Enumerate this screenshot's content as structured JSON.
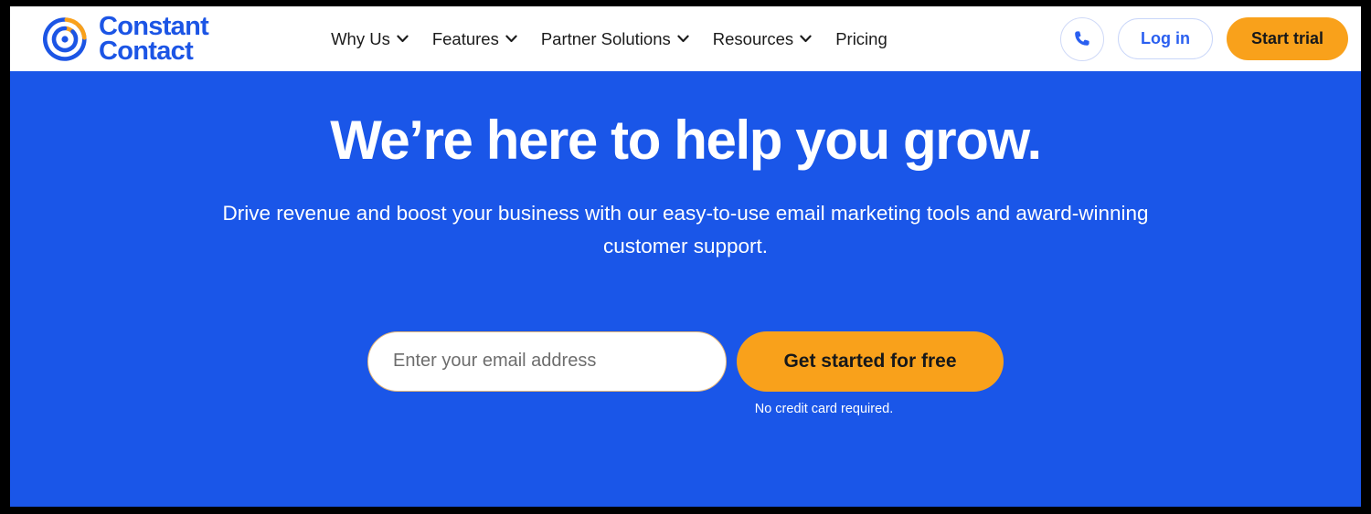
{
  "brand": {
    "name_line1": "Constant",
    "name_line2": "Contact",
    "logo_icon": "constant-contact-logo-icon",
    "blue": "#1a56e8",
    "orange": "#f9a11b",
    "logo_blue": "#1c55e5"
  },
  "header": {
    "nav": [
      {
        "label": "Why Us",
        "has_dropdown": true,
        "icon": "chevron-down-icon"
      },
      {
        "label": "Features",
        "has_dropdown": true,
        "icon": "chevron-down-icon"
      },
      {
        "label": "Partner Solutions",
        "has_dropdown": true,
        "icon": "chevron-down-icon"
      },
      {
        "label": "Resources",
        "has_dropdown": true,
        "icon": "chevron-down-icon"
      },
      {
        "label": "Pricing",
        "has_dropdown": false,
        "icon": ""
      }
    ],
    "phone_icon": "phone-icon",
    "login_label": "Log in",
    "trial_label": "Start trial"
  },
  "hero": {
    "title": "We’re here to help you grow.",
    "subtitle": "Drive revenue and boost your business with our easy-to-use email marketing tools and award-winning customer support.",
    "email_placeholder": "Enter your email address",
    "email_value": "",
    "cta_label": "Get started for free",
    "disclaimer": "No credit card required."
  }
}
